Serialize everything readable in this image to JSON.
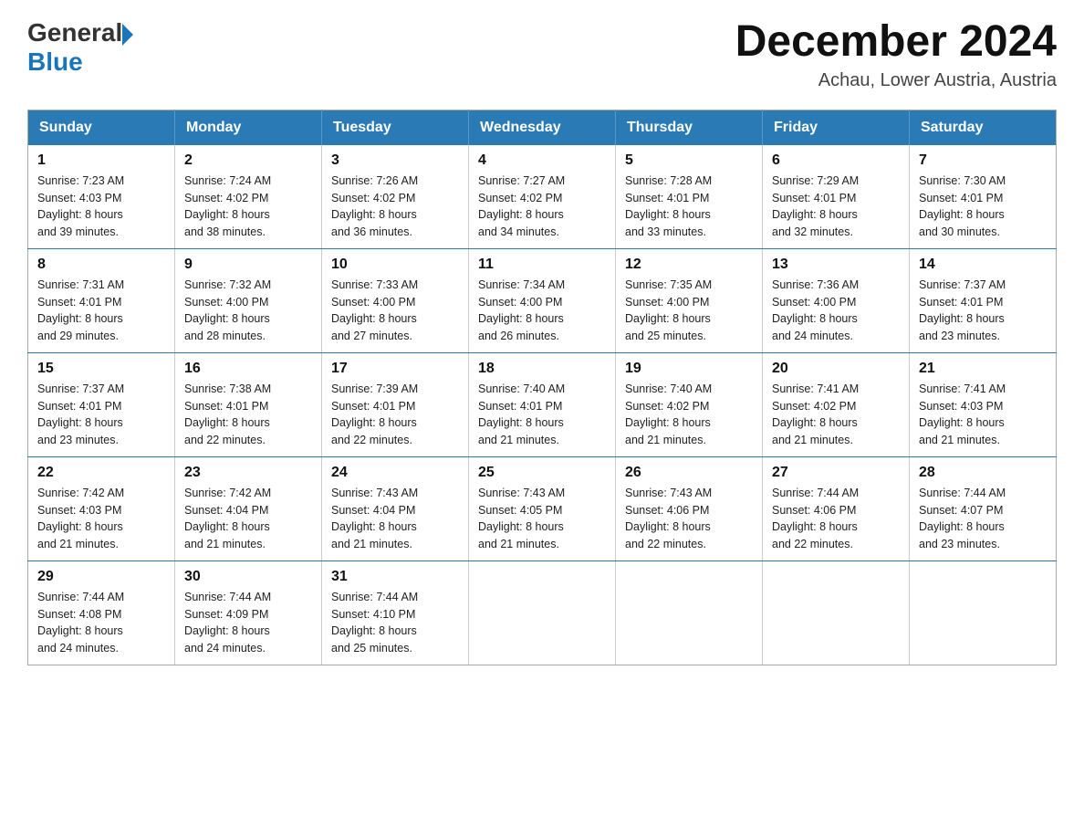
{
  "header": {
    "logo_general": "General",
    "logo_blue": "Blue",
    "title": "December 2024",
    "subtitle": "Achau, Lower Austria, Austria"
  },
  "days_of_week": [
    "Sunday",
    "Monday",
    "Tuesday",
    "Wednesday",
    "Thursday",
    "Friday",
    "Saturday"
  ],
  "weeks": [
    [
      {
        "day": "1",
        "sunrise": "7:23 AM",
        "sunset": "4:03 PM",
        "daylight": "8 hours and 39 minutes."
      },
      {
        "day": "2",
        "sunrise": "7:24 AM",
        "sunset": "4:02 PM",
        "daylight": "8 hours and 38 minutes."
      },
      {
        "day": "3",
        "sunrise": "7:26 AM",
        "sunset": "4:02 PM",
        "daylight": "8 hours and 36 minutes."
      },
      {
        "day": "4",
        "sunrise": "7:27 AM",
        "sunset": "4:02 PM",
        "daylight": "8 hours and 34 minutes."
      },
      {
        "day": "5",
        "sunrise": "7:28 AM",
        "sunset": "4:01 PM",
        "daylight": "8 hours and 33 minutes."
      },
      {
        "day": "6",
        "sunrise": "7:29 AM",
        "sunset": "4:01 PM",
        "daylight": "8 hours and 32 minutes."
      },
      {
        "day": "7",
        "sunrise": "7:30 AM",
        "sunset": "4:01 PM",
        "daylight": "8 hours and 30 minutes."
      }
    ],
    [
      {
        "day": "8",
        "sunrise": "7:31 AM",
        "sunset": "4:01 PM",
        "daylight": "8 hours and 29 minutes."
      },
      {
        "day": "9",
        "sunrise": "7:32 AM",
        "sunset": "4:00 PM",
        "daylight": "8 hours and 28 minutes."
      },
      {
        "day": "10",
        "sunrise": "7:33 AM",
        "sunset": "4:00 PM",
        "daylight": "8 hours and 27 minutes."
      },
      {
        "day": "11",
        "sunrise": "7:34 AM",
        "sunset": "4:00 PM",
        "daylight": "8 hours and 26 minutes."
      },
      {
        "day": "12",
        "sunrise": "7:35 AM",
        "sunset": "4:00 PM",
        "daylight": "8 hours and 25 minutes."
      },
      {
        "day": "13",
        "sunrise": "7:36 AM",
        "sunset": "4:00 PM",
        "daylight": "8 hours and 24 minutes."
      },
      {
        "day": "14",
        "sunrise": "7:37 AM",
        "sunset": "4:01 PM",
        "daylight": "8 hours and 23 minutes."
      }
    ],
    [
      {
        "day": "15",
        "sunrise": "7:37 AM",
        "sunset": "4:01 PM",
        "daylight": "8 hours and 23 minutes."
      },
      {
        "day": "16",
        "sunrise": "7:38 AM",
        "sunset": "4:01 PM",
        "daylight": "8 hours and 22 minutes."
      },
      {
        "day": "17",
        "sunrise": "7:39 AM",
        "sunset": "4:01 PM",
        "daylight": "8 hours and 22 minutes."
      },
      {
        "day": "18",
        "sunrise": "7:40 AM",
        "sunset": "4:01 PM",
        "daylight": "8 hours and 21 minutes."
      },
      {
        "day": "19",
        "sunrise": "7:40 AM",
        "sunset": "4:02 PM",
        "daylight": "8 hours and 21 minutes."
      },
      {
        "day": "20",
        "sunrise": "7:41 AM",
        "sunset": "4:02 PM",
        "daylight": "8 hours and 21 minutes."
      },
      {
        "day": "21",
        "sunrise": "7:41 AM",
        "sunset": "4:03 PM",
        "daylight": "8 hours and 21 minutes."
      }
    ],
    [
      {
        "day": "22",
        "sunrise": "7:42 AM",
        "sunset": "4:03 PM",
        "daylight": "8 hours and 21 minutes."
      },
      {
        "day": "23",
        "sunrise": "7:42 AM",
        "sunset": "4:04 PM",
        "daylight": "8 hours and 21 minutes."
      },
      {
        "day": "24",
        "sunrise": "7:43 AM",
        "sunset": "4:04 PM",
        "daylight": "8 hours and 21 minutes."
      },
      {
        "day": "25",
        "sunrise": "7:43 AM",
        "sunset": "4:05 PM",
        "daylight": "8 hours and 21 minutes."
      },
      {
        "day": "26",
        "sunrise": "7:43 AM",
        "sunset": "4:06 PM",
        "daylight": "8 hours and 22 minutes."
      },
      {
        "day": "27",
        "sunrise": "7:44 AM",
        "sunset": "4:06 PM",
        "daylight": "8 hours and 22 minutes."
      },
      {
        "day": "28",
        "sunrise": "7:44 AM",
        "sunset": "4:07 PM",
        "daylight": "8 hours and 23 minutes."
      }
    ],
    [
      {
        "day": "29",
        "sunrise": "7:44 AM",
        "sunset": "4:08 PM",
        "daylight": "8 hours and 24 minutes."
      },
      {
        "day": "30",
        "sunrise": "7:44 AM",
        "sunset": "4:09 PM",
        "daylight": "8 hours and 24 minutes."
      },
      {
        "day": "31",
        "sunrise": "7:44 AM",
        "sunset": "4:10 PM",
        "daylight": "8 hours and 25 minutes."
      },
      null,
      null,
      null,
      null
    ]
  ],
  "labels": {
    "sunrise": "Sunrise:",
    "sunset": "Sunset:",
    "daylight": "Daylight:"
  }
}
